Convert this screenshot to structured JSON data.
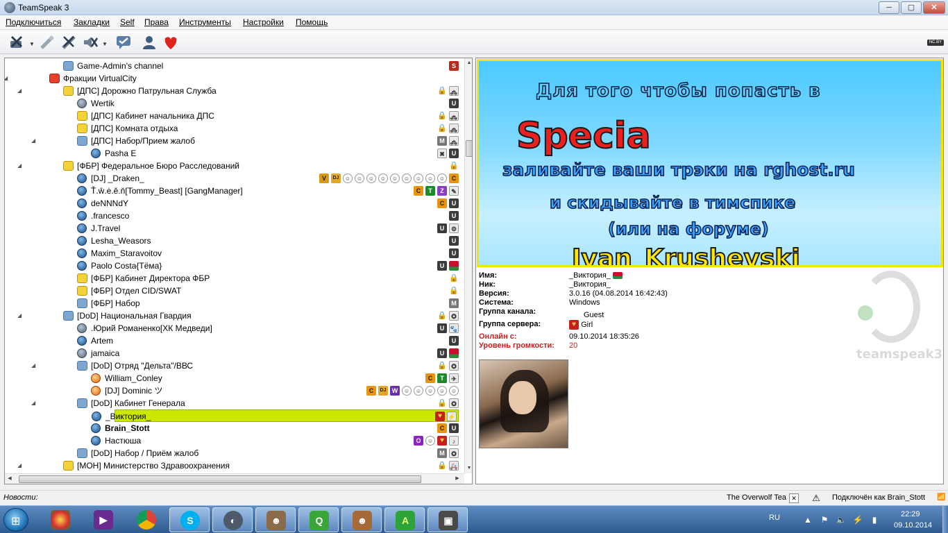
{
  "window": {
    "title": "TeamSpeak 3",
    "min": "─",
    "max": "▢",
    "close": "✕"
  },
  "menu": [
    "Подключиться",
    "Закладки",
    "Self",
    "Права",
    "Инструменты",
    "Настройки",
    "Помощь"
  ],
  "toolbar": {
    "icons": [
      "disconnect-icon",
      "connect-icon",
      "mute-mic-icon",
      "mute-speakers-icon",
      "away-icon",
      "contacts-icon",
      "teamspeak-logo-icon"
    ],
    "logo_text": "NC.BY"
  },
  "tree": {
    "rows": [
      {
        "label": "Game-Admin's channel",
        "level": 1,
        "kind": "channel",
        "color": "blue",
        "arrow": "",
        "badges": [
          {
            "t": "S"
          }
        ]
      },
      {
        "label": "Фракции VirtualCity",
        "level": 0,
        "kind": "channel",
        "color": "red",
        "arrow": "◢",
        "badges": []
      },
      {
        "label": "[ДПС] Дорожно Патрульная Служба",
        "level": 1,
        "kind": "channel",
        "color": "yellow",
        "arrow": "◢",
        "badges": [
          {
            "t": "lock",
            "g": "🔒"
          },
          {
            "t": "pic",
            "g": "🚓"
          }
        ]
      },
      {
        "label": "Wertik",
        "level": 2,
        "kind": "user",
        "color": "muted",
        "arrow": "",
        "badges": [
          {
            "t": "U"
          }
        ]
      },
      {
        "label": "[ДПС] Кабинет начальника ДПС",
        "level": 2,
        "kind": "channel",
        "color": "yellow",
        "arrow": "",
        "badges": [
          {
            "t": "lock",
            "g": "🔒"
          },
          {
            "t": "pic",
            "g": "🚓"
          }
        ]
      },
      {
        "label": "[ДПС] Комната отдыха",
        "level": 2,
        "kind": "channel",
        "color": "yellow",
        "arrow": "",
        "badges": [
          {
            "t": "lock",
            "g": "🔒"
          },
          {
            "t": "pic",
            "g": "🚓"
          }
        ]
      },
      {
        "label": "[ДПС] Набор/Прием жалоб",
        "level": 2,
        "kind": "channel",
        "color": "blue",
        "arrow": "◢",
        "badges": [
          {
            "t": "M"
          },
          {
            "t": "pic",
            "g": "🚓"
          }
        ]
      },
      {
        "label": "Pasha E",
        "level": 3,
        "kind": "user",
        "color": "blue",
        "arrow": "",
        "badges": [
          {
            "t": "pic",
            "g": "✖"
          },
          {
            "t": "U"
          }
        ]
      },
      {
        "label": "[ФБР] Федеральное Бюро Расследований",
        "level": 1,
        "kind": "channel",
        "color": "yellow",
        "arrow": "◢",
        "badges": [
          {
            "t": "lock",
            "g": "🔒"
          }
        ]
      },
      {
        "label": "[DJ] _Draken_",
        "level": 2,
        "kind": "user",
        "color": "blue",
        "arrow": "",
        "badges": [
          {
            "t": "V"
          },
          {
            "t": "DJ"
          },
          {
            "t": "face",
            "g": "☺"
          },
          {
            "t": "face",
            "g": "☺"
          },
          {
            "t": "face",
            "g": "☺"
          },
          {
            "t": "face",
            "g": "☺"
          },
          {
            "t": "face",
            "g": "☺"
          },
          {
            "t": "face",
            "g": "☺"
          },
          {
            "t": "face",
            "g": "☺"
          },
          {
            "t": "face",
            "g": "☺"
          },
          {
            "t": "face",
            "g": "☺"
          },
          {
            "t": "C"
          }
        ]
      },
      {
        "label": "Ť.ŵ.ė.ě.ň[Tommy_Beast] [GangManager]",
        "level": 2,
        "kind": "user",
        "color": "blue",
        "arrow": "",
        "badges": [
          {
            "t": "C"
          },
          {
            "t": "T"
          },
          {
            "t": "Z"
          },
          {
            "t": "pic",
            "g": "✎"
          }
        ]
      },
      {
        "label": "deNNNdY",
        "level": 2,
        "kind": "user",
        "color": "blue",
        "arrow": "",
        "badges": [
          {
            "t": "C"
          },
          {
            "t": "U"
          }
        ]
      },
      {
        "label": ".francesco",
        "level": 2,
        "kind": "user",
        "color": "blue",
        "arrow": "",
        "badges": [
          {
            "t": "U"
          }
        ]
      },
      {
        "label": "J.Travel",
        "level": 2,
        "kind": "user",
        "color": "blue",
        "arrow": "",
        "badges": [
          {
            "t": "U"
          },
          {
            "t": "pic",
            "g": "⚙"
          }
        ]
      },
      {
        "label": "Lesha_Weasors",
        "level": 2,
        "kind": "user",
        "color": "blue",
        "arrow": "",
        "badges": [
          {
            "t": "U"
          }
        ]
      },
      {
        "label": "Maxim_Staravoitov",
        "level": 2,
        "kind": "user",
        "color": "blue",
        "arrow": "",
        "badges": [
          {
            "t": "U"
          }
        ]
      },
      {
        "label": "Paolo Costa{Тёма}",
        "level": 2,
        "kind": "user",
        "color": "blue",
        "arrow": "",
        "badges": [
          {
            "t": "U"
          },
          {
            "t": "flag"
          }
        ]
      },
      {
        "label": "[ФБР] Кабинет Директора ФБР",
        "level": 2,
        "kind": "channel",
        "color": "yellow",
        "arrow": "",
        "badges": [
          {
            "t": "lock",
            "g": "🔒"
          }
        ]
      },
      {
        "label": "[ФБР] Отдел CID/SWAT",
        "level": 2,
        "kind": "channel",
        "color": "yellow",
        "arrow": "",
        "badges": [
          {
            "t": "lock",
            "g": "🔒"
          }
        ]
      },
      {
        "label": "[ФБР] Набор",
        "level": 2,
        "kind": "channel",
        "color": "blue",
        "arrow": "",
        "badges": [
          {
            "t": "M"
          }
        ]
      },
      {
        "label": "[DoD] Национальная Гвардия",
        "level": 1,
        "kind": "channel",
        "color": "blue",
        "arrow": "◢",
        "badges": [
          {
            "t": "lock",
            "g": "🔒"
          },
          {
            "t": "pic",
            "g": "✪"
          }
        ]
      },
      {
        "label": ".Юрий Романенко[ХК Медведи]",
        "level": 2,
        "kind": "user",
        "color": "muted",
        "arrow": "",
        "badges": [
          {
            "t": "U"
          },
          {
            "t": "pic",
            "g": "🐾"
          }
        ]
      },
      {
        "label": "Artem",
        "level": 2,
        "kind": "user",
        "color": "blue",
        "arrow": "",
        "badges": [
          {
            "t": "U"
          }
        ]
      },
      {
        "label": "jamaica",
        "level": 2,
        "kind": "user",
        "color": "muted",
        "arrow": "",
        "badges": [
          {
            "t": "U"
          },
          {
            "t": "flag"
          }
        ]
      },
      {
        "label": "[DoD] Отряд \"Дельта\"/ВВС",
        "level": 2,
        "kind": "channel",
        "color": "blue",
        "arrow": "◢",
        "badges": [
          {
            "t": "lock",
            "g": "🔒"
          },
          {
            "t": "pic",
            "g": "✪"
          }
        ]
      },
      {
        "label": "William_Conley",
        "level": 3,
        "kind": "user",
        "color": "orange",
        "arrow": "",
        "badges": [
          {
            "t": "C"
          },
          {
            "t": "T"
          },
          {
            "t": "pic",
            "g": "✈"
          }
        ]
      },
      {
        "label": "[DJ] Dominic ツ",
        "level": 3,
        "kind": "user",
        "color": "orange",
        "arrow": "",
        "badges": [
          {
            "t": "C"
          },
          {
            "t": "DJ"
          },
          {
            "t": "W"
          },
          {
            "t": "face",
            "g": "☺"
          },
          {
            "t": "face",
            "g": "☺"
          },
          {
            "t": "face",
            "g": "☺"
          },
          {
            "t": "face",
            "g": "☺"
          },
          {
            "t": "face",
            "g": "☺"
          }
        ]
      },
      {
        "label": "[DoD] Кабинет Генерала",
        "level": 2,
        "kind": "channel",
        "color": "blue",
        "arrow": "◢",
        "badges": [
          {
            "t": "lock",
            "g": "🔒"
          },
          {
            "t": "pic",
            "g": "✪"
          }
        ]
      },
      {
        "label": "_Виктория_",
        "level": 3,
        "kind": "user",
        "color": "blue",
        "arrow": "",
        "selected": true,
        "badges": [
          {
            "t": "heart",
            "g": "♥"
          },
          {
            "t": "pic",
            "g": "⚡"
          }
        ]
      },
      {
        "label": "Brain_Stott",
        "level": 3,
        "kind": "user",
        "color": "blue",
        "arrow": "",
        "bold": true,
        "badges": [
          {
            "t": "C"
          },
          {
            "t": "U"
          }
        ]
      },
      {
        "label": "Настюша",
        "level": 3,
        "kind": "user",
        "color": "blue",
        "arrow": "",
        "badges": [
          {
            "t": "O"
          },
          {
            "t": "face",
            "g": "☺"
          },
          {
            "t": "heart",
            "g": "♥"
          },
          {
            "t": "pic",
            "g": "♪"
          }
        ]
      },
      {
        "label": "[DoD] Набор / Приём жалоб",
        "level": 2,
        "kind": "channel",
        "color": "blue",
        "arrow": "",
        "badges": [
          {
            "t": "M"
          },
          {
            "t": "pic",
            "g": "✪"
          }
        ]
      },
      {
        "label": "[МОН] Министерство Здравоохранения",
        "level": 1,
        "kind": "channel",
        "color": "yellow",
        "arrow": "◢",
        "badges": [
          {
            "t": "lock",
            "g": "🔒"
          },
          {
            "t": "pic",
            "g": "🚑"
          }
        ]
      }
    ]
  },
  "banner": {
    "line1": "Для того чтобы попасть в",
    "line2": "Specia",
    "line3": "заливайте ваши трэки на rghost.ru",
    "line4": "и скидывайте  в тимспике",
    "line5": "(или на форуме)",
    "line6": "Ivan_Krushevski"
  },
  "info": {
    "name_label": "Имя:",
    "name_value": "_Виктория_",
    "nick_label": "Ник:",
    "nick_value": "_Виктория_",
    "version_label": "Версия:",
    "version_value": "3.0.16 (04.08.2014 16:42:43)",
    "system_label": "Система:",
    "system_value": "Windows",
    "channel_group_label": "Группа канала:",
    "channel_group_value": "Guest",
    "server_group_label": "Группа сервера:",
    "server_group_value": "Girl",
    "online_label": "Онлайн с:",
    "online_value": "09.10.2014 18:35:26",
    "volume_label": "Уровень громкости:",
    "volume_value": "20",
    "watermark": "teamspeak3"
  },
  "statusbar": {
    "news_label": "Новости:",
    "notice": "The Overwolf Tea",
    "status": "Подключён как Brain_Stott"
  },
  "taskbar": {
    "apps": [
      "chrome-ball-icon",
      "video-app-icon",
      "chrome-icon",
      "skype-icon",
      "teamspeak-icon",
      "game-avatar-icon",
      "quicktime-icon",
      "gta-char-icon",
      "font-app-icon",
      "monitor-app-icon"
    ],
    "lang": "RU",
    "time": "22:29",
    "date": "09.10.2014"
  },
  "colors": {
    "selection": "#cbe800",
    "accent_red": "#d21a1a"
  }
}
